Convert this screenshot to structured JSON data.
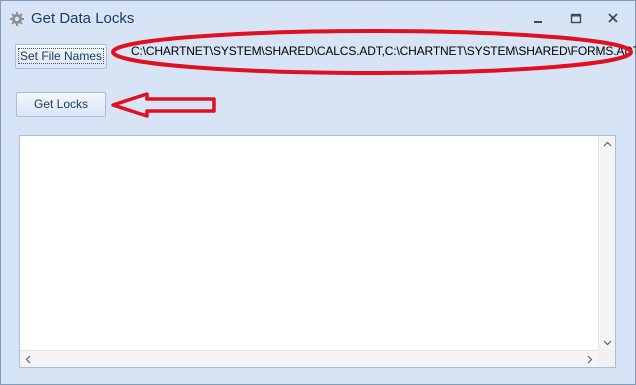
{
  "window": {
    "title": "Get Data Locks",
    "icon": "gear-icon",
    "controls": [
      "minimize-icon",
      "maximize-icon",
      "close-icon"
    ]
  },
  "toolbar": {
    "set_file_names_label": "Set File Names",
    "get_locks_label": "Get Locks"
  },
  "file_names": {
    "value": "C:\\CHARTNET\\SYSTEM\\SHARED\\CALCS.ADT,C:\\CHARTNET\\SYSTEM\\SHARED\\FORMS.ADT"
  },
  "annotations": {
    "highlight_color": "#e01020",
    "shapes": [
      "ellipse-around-file-names",
      "arrow-pointing-to-get-locks"
    ]
  },
  "results_list": {
    "items": []
  },
  "colors": {
    "window_bg": "#d6e4f5",
    "title_text": "#1e395b",
    "annotation_red": "#e01020"
  }
}
